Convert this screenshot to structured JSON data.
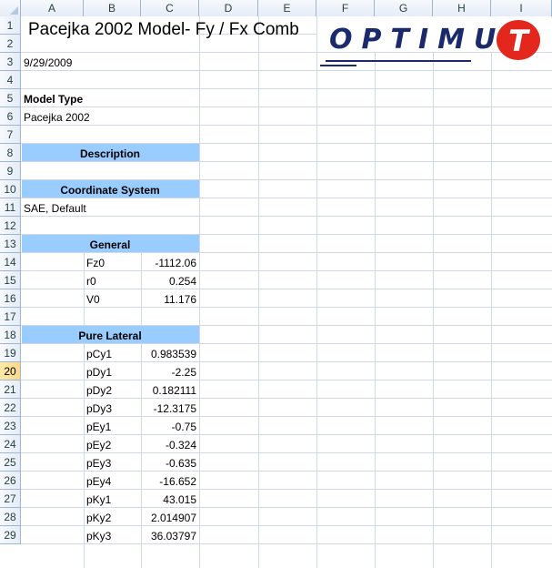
{
  "columns": [
    "A",
    "B",
    "C",
    "D",
    "E",
    "F",
    "G",
    "H",
    "I"
  ],
  "rows": [
    "1",
    "2",
    "3",
    "4",
    "5",
    "6",
    "7",
    "8",
    "9",
    "10",
    "11",
    "12",
    "13",
    "14",
    "15",
    "16",
    "17",
    "18",
    "19",
    "20",
    "21",
    "22",
    "23",
    "24",
    "25",
    "26",
    "27",
    "28",
    "29"
  ],
  "active_row": "20",
  "title": "Pacejka 2002 Model- Fy / Fx Comb",
  "logo_text": "OPTIMUM",
  "logo_mark": "T",
  "logo_colors": {
    "text": "#1a2a6c",
    "mark": "#e3271c"
  },
  "header_fill": "#99ccff",
  "date": "9/29/2009",
  "model_type_label": "Model Type",
  "model_type_value": "Pacejka 2002",
  "description_header": "Description",
  "coord_header": "Coordinate System",
  "coord_value": "SAE, Default",
  "general_header": "General",
  "general_params": [
    {
      "name": "Fz0",
      "value": "-1112.06"
    },
    {
      "name": "r0",
      "value": "0.254"
    },
    {
      "name": "V0",
      "value": "11.176"
    }
  ],
  "lateral_header": "Pure Lateral",
  "lateral_params": [
    {
      "name": "pCy1",
      "value": "0.983539"
    },
    {
      "name": "pDy1",
      "value": "-2.25"
    },
    {
      "name": "pDy2",
      "value": "0.182111"
    },
    {
      "name": "pDy3",
      "value": "-12.3175"
    },
    {
      "name": "pEy1",
      "value": "-0.75"
    },
    {
      "name": "pEy2",
      "value": "-0.324"
    },
    {
      "name": "pEy3",
      "value": "-0.635"
    },
    {
      "name": "pEy4",
      "value": "-16.652"
    },
    {
      "name": "pKy1",
      "value": "43.015"
    },
    {
      "name": "pKy2",
      "value": "2.014907"
    },
    {
      "name": "pKy3",
      "value": "36.03797"
    }
  ]
}
